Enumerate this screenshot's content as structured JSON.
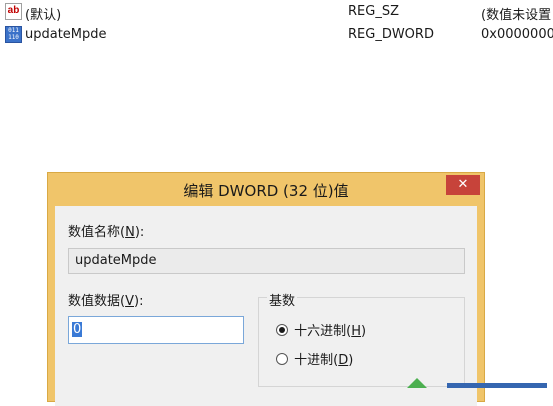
{
  "registry": {
    "rows": [
      {
        "icon": "string-value-icon",
        "icon_text": "ab",
        "name": "(默认)",
        "type": "REG_SZ",
        "data": "(数值未设置"
      },
      {
        "icon": "binary-value-icon",
        "icon_text": "011 110",
        "name": "updateMpde",
        "type": "REG_DWORD",
        "data": "0x0000000"
      }
    ]
  },
  "dialog": {
    "title": "编辑 DWORD (32 位)值",
    "close_glyph": "✕",
    "value_name_label": "数值名称",
    "value_name_key": "N",
    "value_name": "updateMpde",
    "value_data_label": "数值数据",
    "value_data_key": "V",
    "value_data": "0",
    "base_label": "基数",
    "base_options": [
      {
        "label": "十六进制",
        "key": "H",
        "checked": true
      },
      {
        "label": "十进制",
        "key": "D",
        "checked": false
      }
    ]
  },
  "colors": {
    "titlebar": "#f0c56a",
    "close": "#c7433a",
    "selection": "#3a7ad6"
  }
}
